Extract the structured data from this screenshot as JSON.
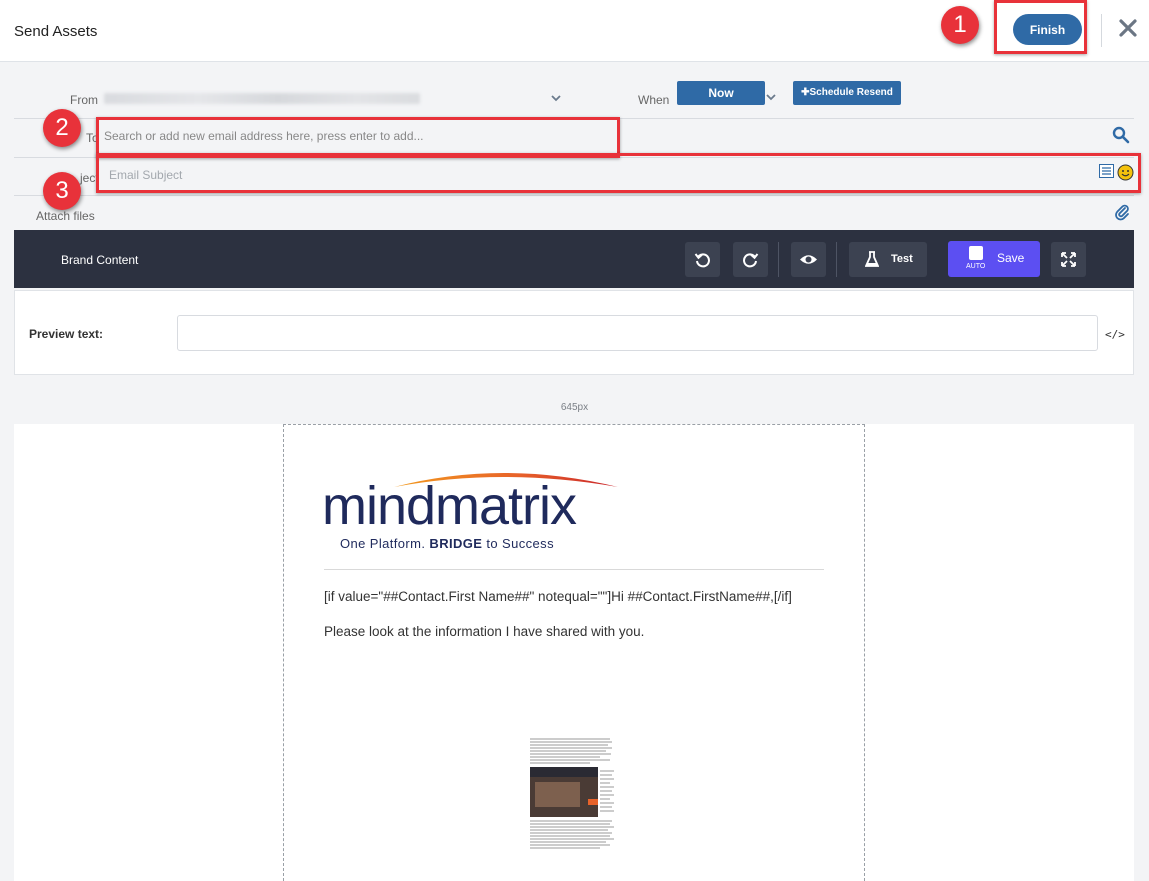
{
  "header": {
    "title": "Send Assets",
    "finish_label": "Finish"
  },
  "form": {
    "from_label": "From",
    "when_label": "When",
    "now_label": "Now",
    "schedule_label": "Schedule Resend",
    "to_label": "To",
    "to_placeholder": "Search or add new email address here, press enter to add...",
    "subject_label": "ject",
    "subject_placeholder": "Email Subject",
    "attach_label": "Attach files"
  },
  "editor": {
    "toolbar_title": "Brand Content",
    "test_label": "Test",
    "save_label": "Save",
    "auto_label": "AUTO",
    "preview_label": "Preview text:",
    "code_icon_text": "</>",
    "width_label": "645px"
  },
  "email": {
    "logo_word": "mindmatrix",
    "logo_tagline_pre": "One Platform. ",
    "logo_tagline_bold": "BRIDGE",
    "logo_tagline_post": " to Success",
    "line1": "[if value=\"##Contact.First Name##\" notequal=\"\"]Hi ##Contact.FirstName##,[/if]",
    "line2": "Please look at the information I have shared with you."
  },
  "annotations": [
    "1",
    "2",
    "3"
  ],
  "colors": {
    "primary": "#2f6aa6",
    "toolbar": "#2c3140",
    "save": "#5c4ff2",
    "annotation": "#e8323a",
    "logo_navy": "#1f2a5c",
    "logo_arc": "#e8632a"
  }
}
